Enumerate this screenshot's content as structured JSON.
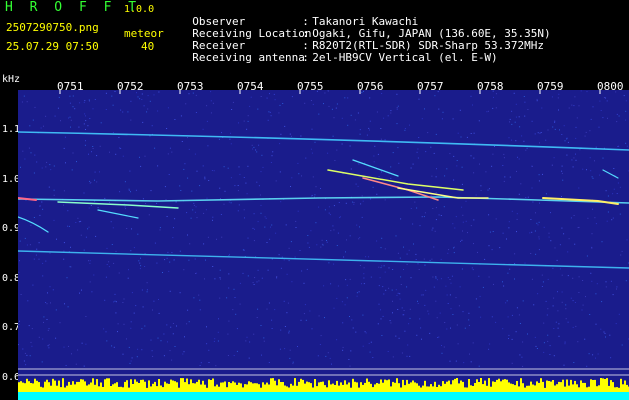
{
  "header": {
    "app_title": "H R O F F T",
    "version": "1.0.0",
    "filename": "2507290750.png",
    "datetime": "25.07.29 07:50",
    "meteor_label": "meteor",
    "meteor_count": "40"
  },
  "info": [
    {
      "key": "Observer",
      "value": "Takanori Kawachi"
    },
    {
      "key": "Receiving Location",
      "value": "Ogaki, Gifu, JAPAN (136.60E, 35.35N)"
    },
    {
      "key": "Receiver",
      "value": "R820T2(RTL-SDR) SDR-Sharp 53.372MHz"
    },
    {
      "key": "Receiving antenna",
      "value": "2el-HB9CV Vertical (el. E-W)"
    }
  ],
  "axis": {
    "unit": "kHz",
    "time_ticks": [
      "0751",
      "0752",
      "0753",
      "0754",
      "0755",
      "0756",
      "0757",
      "0758",
      "0759",
      "0800"
    ],
    "freq_ticks": [
      "1.1",
      "1.0",
      "0.9",
      "0.8",
      "0.7",
      "0.6"
    ]
  },
  "colors": {
    "background": "#1a1c8c",
    "label": "#33ff33",
    "noise_bar": "#ffff00",
    "baseline": "#00ffff"
  }
}
